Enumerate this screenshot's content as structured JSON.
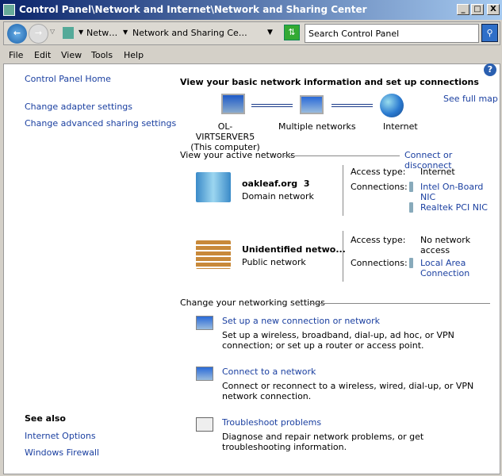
{
  "window": {
    "title": "Control Panel\\Network and Internet\\Network and Sharing Center",
    "min": "_",
    "max": "□",
    "close": "X"
  },
  "address": {
    "crumb1": "Netw…",
    "crumb2": "Network and Sharing Ce…",
    "search_placeholder": "Search Control Panel"
  },
  "menu": [
    "File",
    "Edit",
    "View",
    "Tools",
    "Help"
  ],
  "sidebar": {
    "home": "Control Panel Home",
    "items": [
      "Change adapter settings",
      "Change advanced sharing settings"
    ],
    "see_also": "See also",
    "see_also_items": [
      "Internet Options",
      "Windows Firewall"
    ]
  },
  "main": {
    "heading": "View your basic network information and set up connections",
    "see_full_map": "See full map",
    "map": {
      "computer": "OL-VIRTSERVER5",
      "computer_sub": "(This computer)",
      "middle": "Multiple networks",
      "internet": "Internet"
    },
    "active_label": "View your active networks",
    "connect_link": "Connect or disconnect",
    "networks": [
      {
        "name": "oakleaf.org  3",
        "type": "Domain network",
        "access_label": "Access type:",
        "access": "Internet",
        "conn_label": "Connections:",
        "connections": [
          "Intel On-Board NIC",
          "Realtek PCI NIC"
        ]
      },
      {
        "name": "Unidentified netwo...",
        "type": "Public network",
        "access_label": "Access type:",
        "access": "No network access",
        "conn_label": "Connections:",
        "connections": [
          "Local Area Connection"
        ]
      }
    ],
    "change_label": "Change your networking settings",
    "tasks": [
      {
        "title": "Set up a new connection or network",
        "desc": "Set up a wireless, broadband, dial-up, ad hoc, or VPN connection; or set up a router or access point."
      },
      {
        "title": "Connect to a network",
        "desc": "Connect or reconnect to a wireless, wired, dial-up, or VPN network connection."
      },
      {
        "title": "Troubleshoot problems",
        "desc": "Diagnose and repair network problems, or get troubleshooting information."
      }
    ]
  }
}
